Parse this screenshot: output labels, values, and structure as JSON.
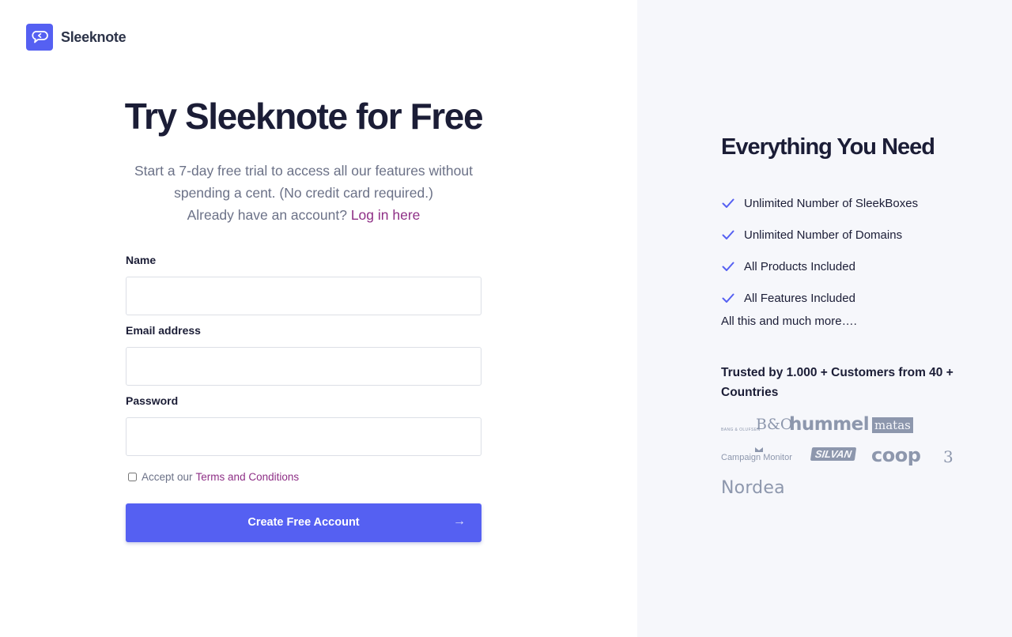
{
  "brand": {
    "logo_text": "Sleeknote",
    "logo_icon": "chat-bubble-arrow-icon",
    "accent_color": "#5560f2",
    "link_color": "#8e2f86"
  },
  "signup": {
    "title": "Try Sleeknote for Free",
    "subtitle_line1": "Start a 7-day free trial to access all our features without",
    "subtitle_line2": "spending a cent. (No credit card required.)",
    "login_prompt": "Already have an account?",
    "login_link": "Log in here",
    "fields": {
      "name": {
        "label": "Name",
        "value": "",
        "placeholder": ""
      },
      "email": {
        "label": "Email address",
        "value": "",
        "placeholder": ""
      },
      "password": {
        "label": "Password",
        "value": "",
        "placeholder": ""
      }
    },
    "terms": {
      "prefix": "Accept our",
      "link": "Terms and Conditions",
      "checked": false
    },
    "submit": {
      "label": "Create Free Account",
      "arrow": "→"
    }
  },
  "benefits": {
    "title": "Everything You Need",
    "features": [
      "Unlimited Number of SleekBoxes",
      "Unlimited Number of Domains",
      "All Products Included",
      "All Features Included"
    ],
    "more": "All this and much more….",
    "trusted": "Trusted by 1.000 + Customers from 40 + Countries",
    "logos": {
      "bo_small": "BANG & OLUFSEN",
      "bo_big": "B&O",
      "hummel": "hummel",
      "matas": "matas",
      "campaign_monitor": "Campaign Monitor",
      "silvan": "SILVAN",
      "coop": "coop",
      "three": "3",
      "nordea": "Nordea"
    }
  }
}
